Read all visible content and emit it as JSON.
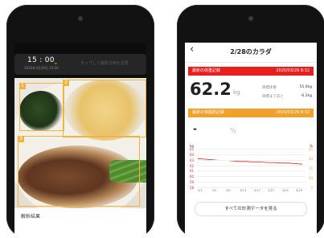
{
  "left_screen": {
    "time": "15 : 00",
    "time_sub": "2020年3月29日 15:00",
    "hint": "タップして撮影日時を変更",
    "boxes": [
      "1",
      "2",
      "3"
    ],
    "analysis_title": "解析結果"
  },
  "right_screen": {
    "title": "2/28のカラダ",
    "latest_weight_label": "最新の体重記録",
    "latest_weight_date": "2020/03/29 8:32",
    "weight_value": "62.2",
    "weight_unit": "kg",
    "target_label": "目標体重",
    "target_value": "55.0kg",
    "to_target_label": "目標まであと",
    "to_target_value": "-6.2kg",
    "latest_fat_label": "最新の体脂肪記録",
    "latest_fat_date": "2020/03/29 8:32",
    "fat_value": "-",
    "fat_unit": "%",
    "see_all_button": "すべての計測データを見る",
    "chart_data": {
      "type": "line",
      "y_unit_left": "kg",
      "y_unit_right": "%",
      "y_ticks_left": [
        "65",
        "64",
        "63",
        "62",
        "61",
        "60",
        "59",
        "58"
      ],
      "y_ticks_right": [
        "25",
        "20",
        "15",
        "10",
        "5"
      ],
      "x_ticks": [
        "3/1",
        "3/5",
        "3/9",
        "3/13",
        "3/17",
        "3/21",
        "3/25",
        "3/29"
      ],
      "series": [
        {
          "color": "#e81f1f",
          "values": [
            63.2,
            63.1,
            63.0,
            62.9,
            62.9,
            62.8,
            62.7,
            62.7,
            62.6,
            62.6,
            62.5,
            62.5,
            62.4,
            62.4,
            62.3,
            62.2
          ]
        }
      ]
    }
  },
  "colors": {
    "red": "#e81f1f",
    "orange": "#f1a12a",
    "detect_box": "#f3b23a"
  },
  "icons": {
    "back": "chevron-left-icon",
    "time_chevron": "chevron-down-icon"
  }
}
